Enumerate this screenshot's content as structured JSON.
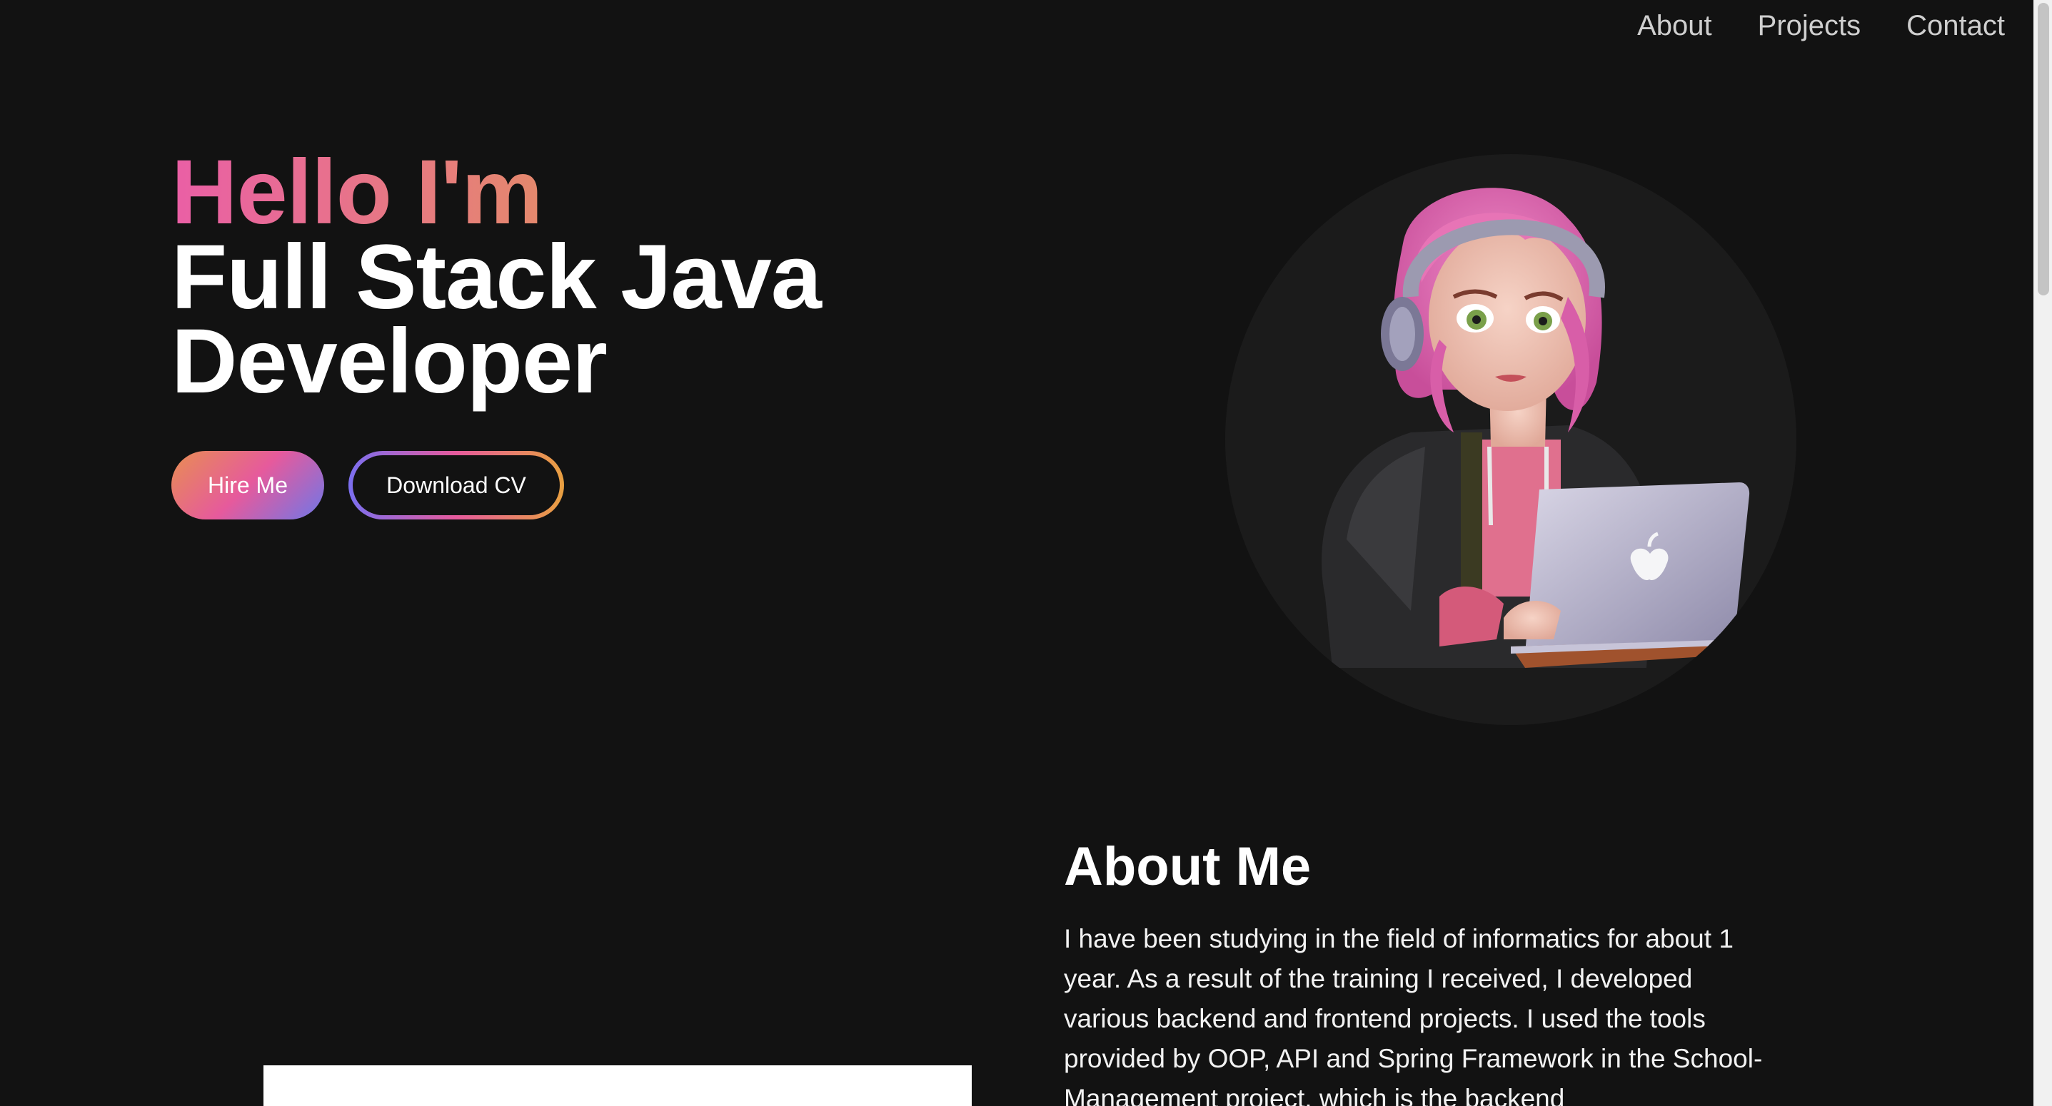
{
  "nav": {
    "items": [
      {
        "label": "About"
      },
      {
        "label": "Projects"
      },
      {
        "label": "Contact"
      }
    ]
  },
  "hero": {
    "greeting": "Hello I'm",
    "role": "Full Stack Java Developer",
    "hire_label": "Hire Me",
    "cv_label": "Download CV"
  },
  "about": {
    "title": "About Me",
    "text": "I have been studying in the field of informatics for about 1 year. As a result of the training I received, I developed various backend and frontend projects. I used the tools provided by OOP, API and Spring Framework in the School-Management project, which is the backend"
  },
  "colors": {
    "background": "#121212",
    "gradient_pink": "#ea5fa6",
    "gradient_orange": "#e2a040",
    "gradient_purple": "#6e77e8"
  },
  "icons": {
    "avatar": "girl-with-laptop-avatar"
  }
}
